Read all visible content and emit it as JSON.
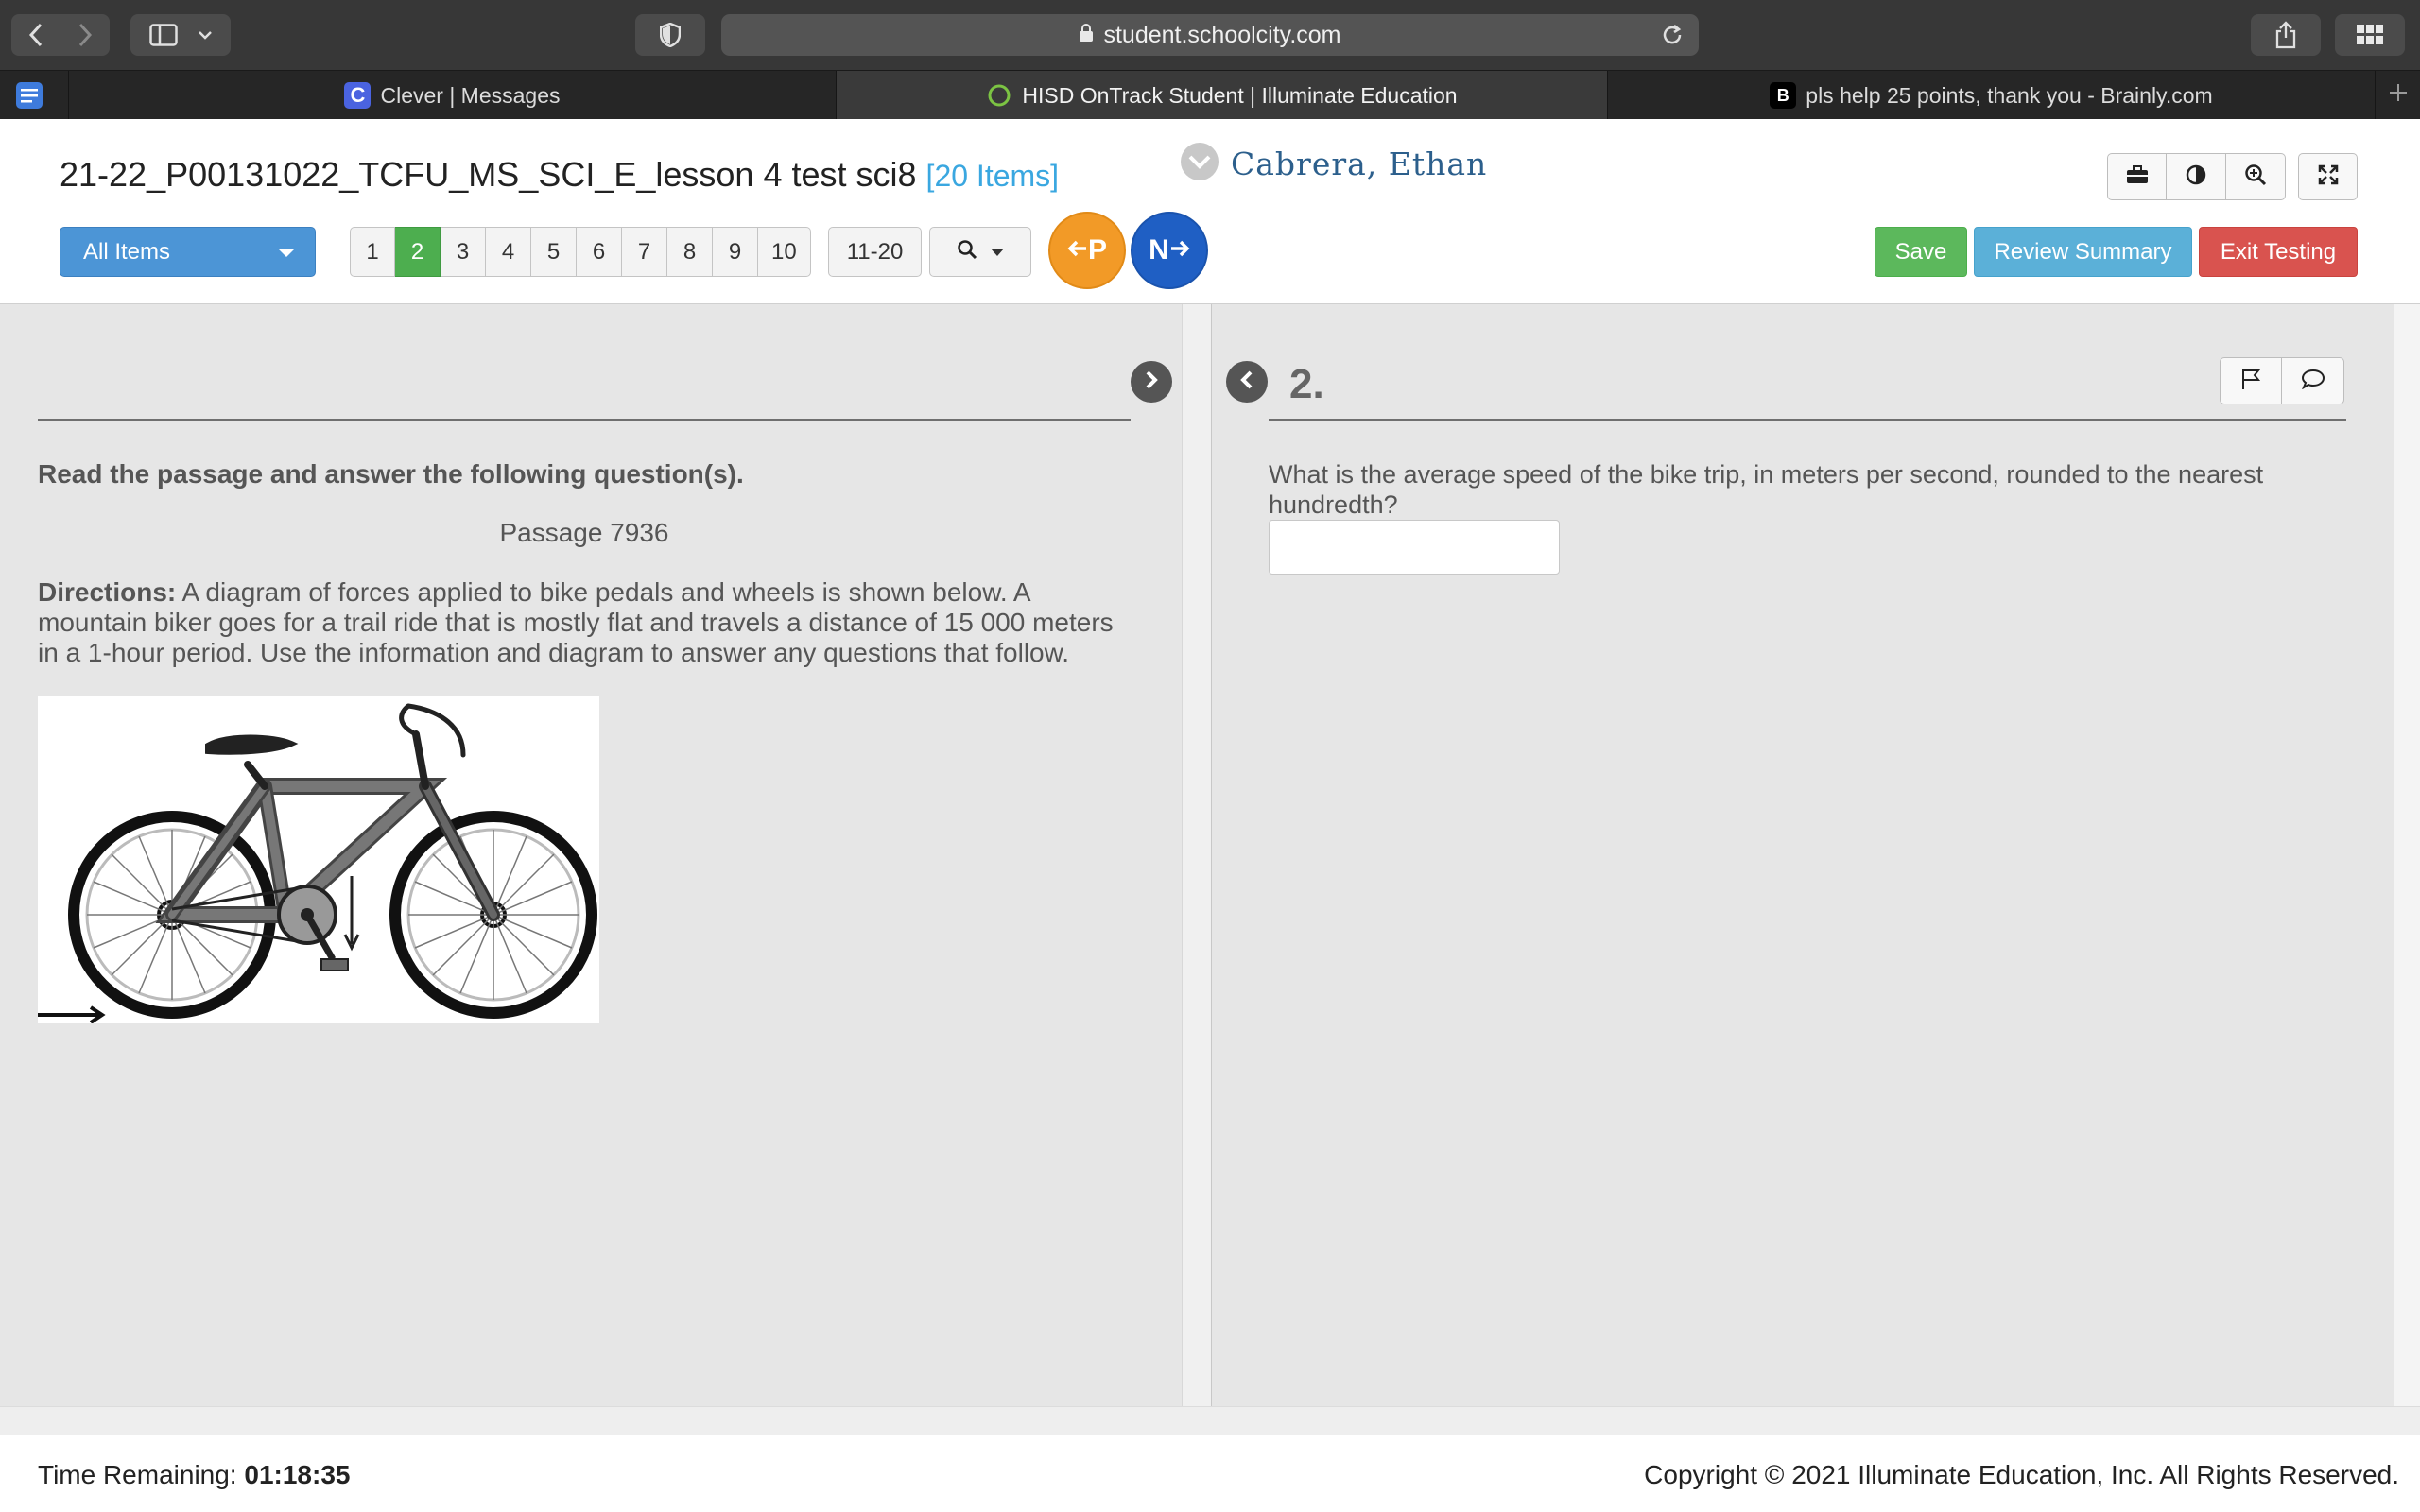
{
  "browser": {
    "url": "student.schoolcity.com",
    "tabs": [
      {
        "label": "Clever | Messages",
        "favicon": "clever-icon",
        "active": false
      },
      {
        "label": "HISD OnTrack Student | Illuminate Education",
        "favicon": "loading-icon",
        "active": true
      },
      {
        "label": "pls help 25 points, thank you - Brainly.com",
        "favicon": "brainly-icon",
        "active": false
      }
    ],
    "favicon_letters": {
      "clever": "C",
      "brainly": "B"
    }
  },
  "header": {
    "test_title": "21-22_P00131022_TCFU_MS_SCI_E_lesson 4 test sci8",
    "item_count": "[20 Items]",
    "student_name": "Cabrera, Ethan",
    "all_items_label": "All Items",
    "pages": [
      "1",
      "2",
      "3",
      "4",
      "5",
      "6",
      "7",
      "8",
      "9",
      "10"
    ],
    "current_page": "2",
    "range_label": "11-20",
    "prev_label": "P",
    "next_label": "N",
    "save_label": "Save",
    "review_label": "Review Summary",
    "exit_label": "Exit Testing",
    "tools": [
      "toolbox-icon",
      "contrast-icon",
      "zoom-icon",
      "fullscreen-icon"
    ]
  },
  "passage": {
    "instruction": "Read the passage and answer the following question(s).",
    "passage_id": "Passage 7936",
    "directions_label": "Directions:",
    "directions_text": " A diagram of forces applied to bike pedals and wheels is shown below. A mountain biker goes for a trail ride that is mostly flat and travels a distance of 15 000 meters in a 1-hour period. Use the information and diagram to answer any questions that follow."
  },
  "question": {
    "number": "2.",
    "text": "What is the average speed of the bike trip, in meters per second, rounded to the nearest hundredth?",
    "answer_value": ""
  },
  "footer": {
    "time_label": "Time Remaining:",
    "time_value": "01:18:35",
    "copyright": "Copyright © 2021 Illuminate Education, Inc. All Rights Reserved."
  },
  "colors": {
    "current_page": "#4dae4f",
    "prev": "#f29a27",
    "next": "#1f5fc4",
    "save": "#5cb85c",
    "review": "#5bb0d8",
    "exit": "#d9534f",
    "item_count": "#3aa7e0",
    "student_name": "#2c5f8c"
  }
}
